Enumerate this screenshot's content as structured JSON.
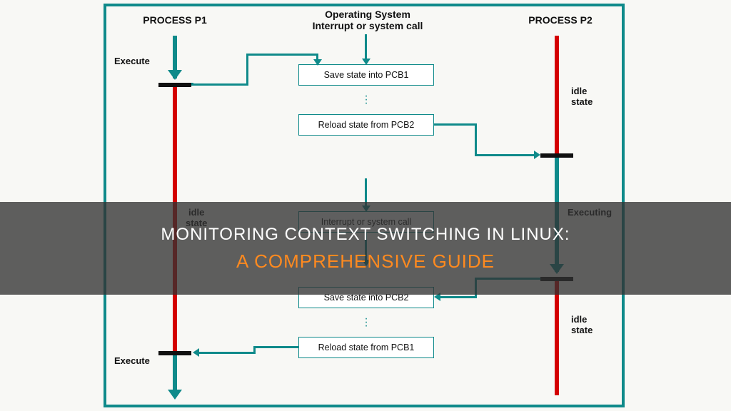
{
  "titles": {
    "p1": "PROCESS P1",
    "os_line1": "Operating System",
    "os_line2": "Interrupt or system call",
    "p2": "PROCESS P2"
  },
  "steps": {
    "save_pcb1": "Save state into PCB1",
    "reload_pcb2": "Reload state from PCB2",
    "interrupt": "Interrupt or system call",
    "save_pcb2": "Save state into PCB2",
    "reload_pcb1": "Reload state from PCB1"
  },
  "labels": {
    "execute_top": "Execute",
    "execute_bottom": "Execute",
    "idle_state_p1": "idle\nstate",
    "idle_state_p2_top": "idle\nstate",
    "executing_p2": "Executing",
    "idle_state_p2_bottom": "idle\nstate"
  },
  "banner": {
    "line1": "MONITORING CONTEXT SWITCHING IN LINUX:",
    "line2": "A COMPREHENSIVE GUIDE"
  }
}
